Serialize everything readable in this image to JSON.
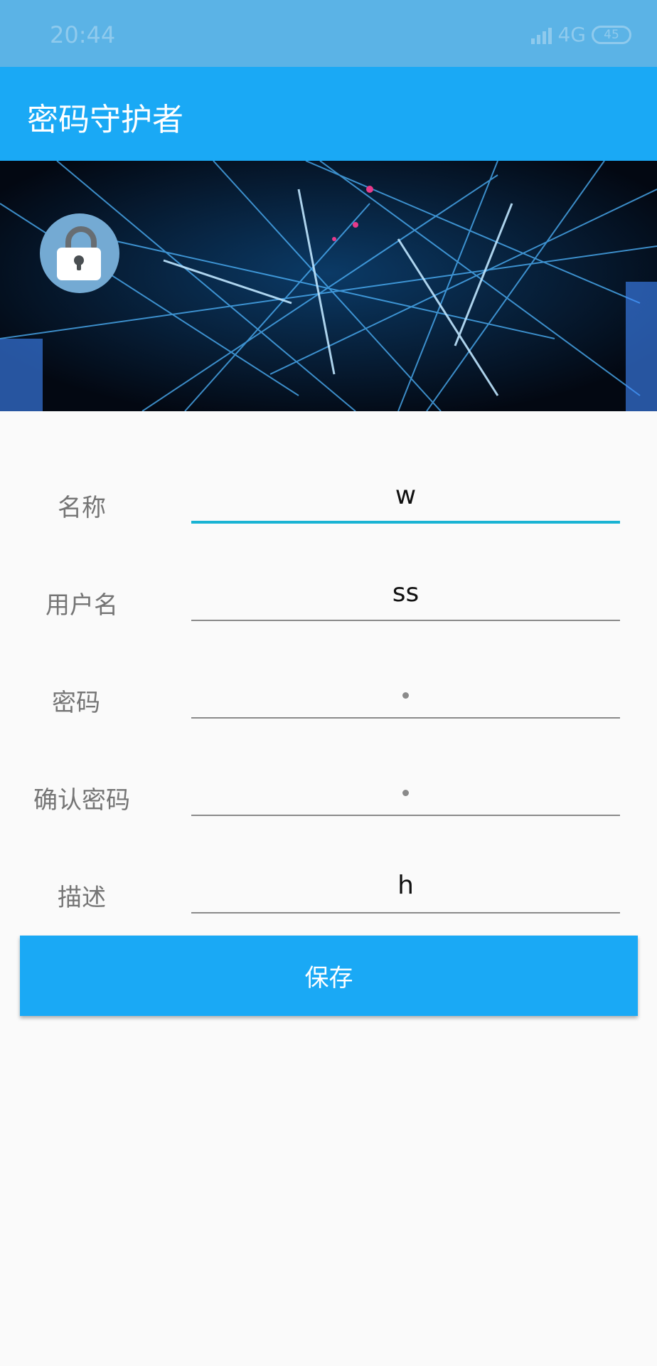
{
  "status_bar": {
    "time": "20:44",
    "network": "4G",
    "battery": "45"
  },
  "app_bar": {
    "title": "密码守护者"
  },
  "banner": {
    "icon": "unlocked-padlock-icon"
  },
  "form": {
    "fields": [
      {
        "label": "名称",
        "value": "w"
      },
      {
        "label": "用户名",
        "value": "ss"
      },
      {
        "label": "密码",
        "value": "•"
      },
      {
        "label": "确认密码",
        "value": "•"
      },
      {
        "label": "描述",
        "value": "h"
      }
    ],
    "save_label": "保存"
  },
  "colors": {
    "primary": "#1aa9f5",
    "status_bar": "#5bb3e6",
    "focus_line": "#19b3d3"
  }
}
